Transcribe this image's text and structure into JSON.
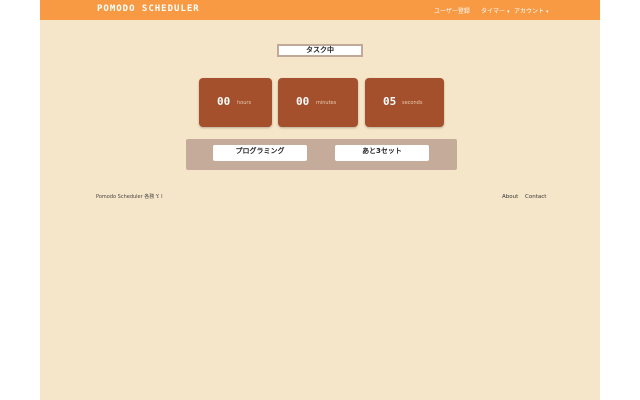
{
  "navbar": {
    "brand": "POMODO SCHEDULER",
    "items": [
      {
        "label": "ユーザー登録"
      },
      {
        "label": "タイマー",
        "caret": "▾"
      },
      {
        "label": "アカウント",
        "caret": "▾"
      }
    ]
  },
  "status": {
    "label": "タスク中"
  },
  "timer": {
    "hours": {
      "value": "00",
      "unit": "hours"
    },
    "minutes": {
      "value": "00",
      "unit": "minutes"
    },
    "seconds": {
      "value": "05",
      "unit": "seconds"
    }
  },
  "task": {
    "name": "プログラミング",
    "remaining": "あと3セット"
  },
  "footer": {
    "copyright": "Pomodo Scheduler 各務 Y. I",
    "about": "About",
    "contact": "Contact"
  },
  "colors": {
    "navbar": "#f79a43",
    "background": "#f6e6c9",
    "timer_card": "#a5502c",
    "task_panel": "#c4ab9a"
  }
}
